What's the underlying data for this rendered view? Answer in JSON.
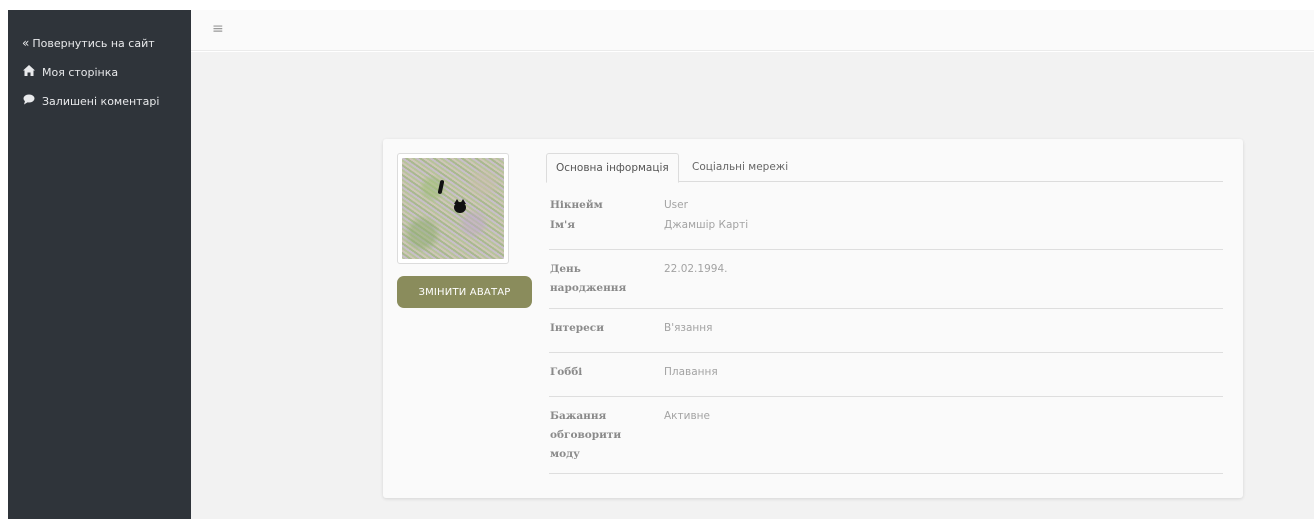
{
  "sidebar": {
    "back": {
      "icon": "double-chevron-left-icon",
      "glyph": "«",
      "label": "Повернутись на сайт"
    },
    "items": [
      {
        "icon": "home-icon",
        "glyph": "🏠",
        "label": "Моя сторінка"
      },
      {
        "icon": "comment-icon",
        "glyph": "💬",
        "label": "Залишені коментарі"
      }
    ]
  },
  "topbar": {
    "menu_icon": "hamburger-menu-icon",
    "menu_glyph": "≡"
  },
  "profile": {
    "change_avatar_label": "ЗМІНИТИ АВАТАР",
    "tabs": [
      {
        "label": "Основна інформація",
        "active": true
      },
      {
        "label": "Соціальні мережі",
        "active": false
      }
    ],
    "fields": {
      "nickname": {
        "label": "Нікнейм",
        "value": "User"
      },
      "name": {
        "label": "Ім'я",
        "value": "Джамшір Карті"
      },
      "birthday": {
        "label": "День народження",
        "value": "22.02.1994."
      },
      "interests": {
        "label": "Інтереси",
        "value": "В'язання"
      },
      "hobby": {
        "label": "Гоббі",
        "value": "Плавання"
      },
      "fashion": {
        "label": "Бажання обговорити моду",
        "value": "Активне"
      }
    }
  },
  "colors": {
    "sidebar_bg": "#2f343a",
    "accent_button": "#8a8c5c",
    "page_bg": "#f2f2f2"
  }
}
